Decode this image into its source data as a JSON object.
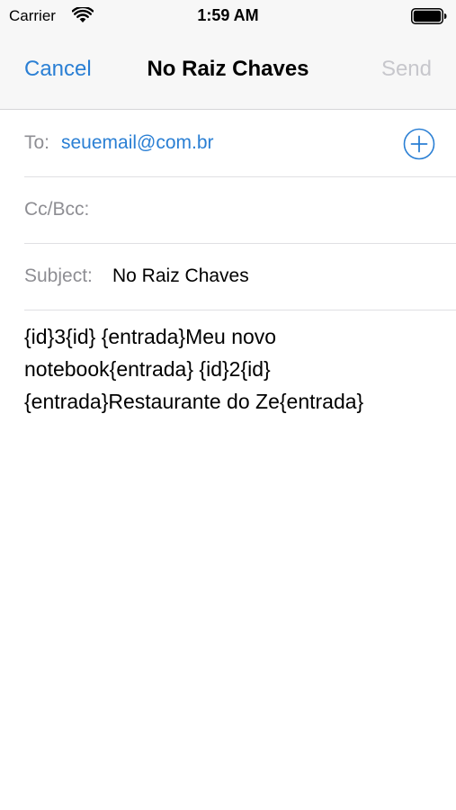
{
  "status_bar": {
    "carrier": "Carrier",
    "time": "1:59 AM",
    "wifi_icon": "wifi-icon",
    "battery_icon": "battery-icon"
  },
  "nav": {
    "cancel_label": "Cancel",
    "title": "No Raiz Chaves",
    "send_label": "Send",
    "accent_color": "#2a7fd4",
    "disabled_color": "#c7c7cc"
  },
  "fields": {
    "to_label": "To:",
    "to_value": "seuemail@com.br",
    "add_icon": "add-contact-icon",
    "cc_label": "Cc/Bcc:",
    "cc_value": "",
    "subject_label": "Subject:",
    "subject_value": "No Raiz Chaves"
  },
  "body": {
    "lines": [
      "{id}3{id} {entrada}Meu novo",
      "notebook{entrada} {id}2{id}",
      "{entrada}Restaurante do Ze{entrada}"
    ]
  }
}
